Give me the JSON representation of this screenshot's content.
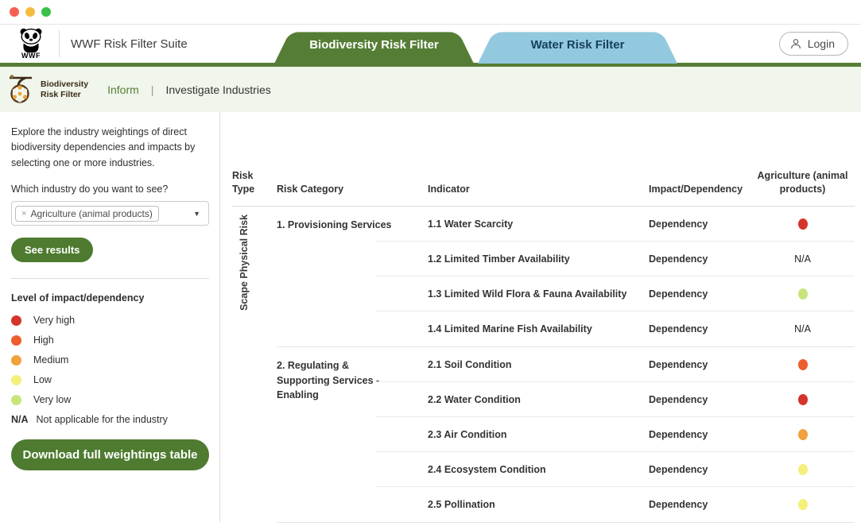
{
  "window": {
    "controls": [
      "close",
      "minimize",
      "zoom"
    ]
  },
  "header": {
    "suite_title": "WWF Risk Filter Suite",
    "logo_word": "WWF",
    "tabs": [
      {
        "label": "Biodiversity Risk Filter",
        "active": true
      },
      {
        "label": "Water Risk Filter",
        "active": false
      }
    ],
    "login_label": "Login"
  },
  "subnav": {
    "logo_line1": "Biodiversity",
    "logo_line2": "Risk Filter",
    "inform_label": "Inform",
    "separator": "|",
    "investigate_label": "Investigate Industries"
  },
  "sidebar": {
    "intro": "Explore the industry weightings of direct biodiversity dependencies and impacts by selecting one or more industries.",
    "question": "Which industry do you want to see?",
    "industry_select": {
      "selected_tag": "Agriculture (animal products)",
      "remove_symbol": "×",
      "caret": "▼"
    },
    "see_results_label": "See results",
    "legend_title": "Level of impact/dependency",
    "legend": [
      {
        "label": "Very high",
        "color": "#d5342b"
      },
      {
        "label": "High",
        "color": "#ec5e2e"
      },
      {
        "label": "Medium",
        "color": "#f0a23d"
      },
      {
        "label": "Low",
        "color": "#f5f07c"
      },
      {
        "label": "Very low",
        "color": "#c9e57a"
      }
    ],
    "na_abbr": "N/A",
    "na_text": "Not applicable for the industry",
    "download_label": "Download full weightings table"
  },
  "table": {
    "headers": {
      "risk_type": "Risk Type",
      "risk_category": "Risk Category",
      "indicator": "Indicator",
      "impact_dependency": "Impact/Dependency",
      "industry": "Agriculture (animal products)"
    },
    "risk_type_label": "Scape Physical Risk",
    "na_label": "N/A",
    "rating_colors": {
      "very_high": "#d5342b",
      "high": "#ec5e2e",
      "medium": "#f0a23d",
      "low": "#f5f07c",
      "very_low": "#c9e57a"
    },
    "sections": [
      {
        "category": "1. Provisioning Services",
        "rows": [
          {
            "indicator": "1.1 Water Scarcity",
            "type": "Dependency",
            "rating": "very_high"
          },
          {
            "indicator": "1.2 Limited Timber Availability",
            "type": "Dependency",
            "rating": "na"
          },
          {
            "indicator": "1.3 Limited Wild Flora & Fauna Availability",
            "type": "Dependency",
            "rating": "very_low"
          },
          {
            "indicator": "1.4 Limited Marine Fish Availability",
            "type": "Dependency",
            "rating": "na"
          }
        ]
      },
      {
        "category": "2. Regulating & Supporting Services - Enabling",
        "rows": [
          {
            "indicator": "2.1 Soil Condition",
            "type": "Dependency",
            "rating": "high"
          },
          {
            "indicator": "2.2 Water Condition",
            "type": "Dependency",
            "rating": "very_high"
          },
          {
            "indicator": "2.3 Air Condition",
            "type": "Dependency",
            "rating": "medium"
          },
          {
            "indicator": "2.4 Ecosystem Condition",
            "type": "Dependency",
            "rating": "low"
          },
          {
            "indicator": "2.5 Pollination",
            "type": "Dependency",
            "rating": "low"
          }
        ]
      }
    ]
  },
  "colors": {
    "brand_green": "#567d35",
    "button_green": "#4e7b2f",
    "tab_blue": "#92c9df",
    "subnav_bg": "#f0f6eb"
  }
}
